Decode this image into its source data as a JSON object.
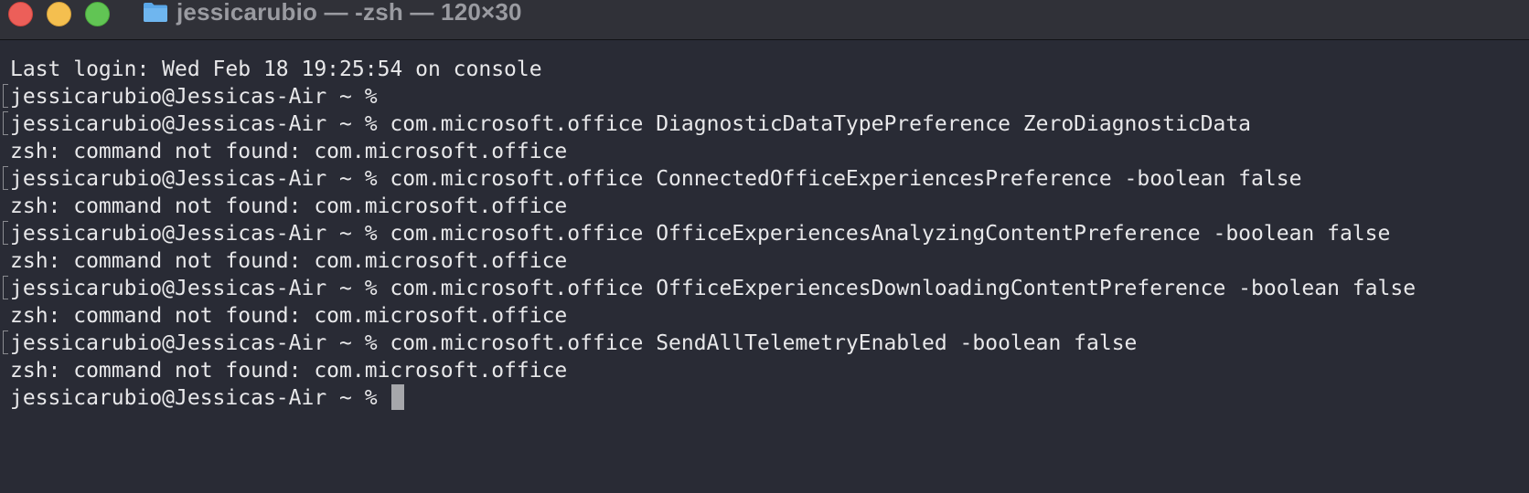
{
  "window": {
    "title": "jessicarubio — -zsh — 120×30",
    "icon": "folder-icon"
  },
  "terminal": {
    "lines": [
      {
        "text": "Last login: Wed Feb 18 19:25:54 on console",
        "marked": false
      },
      {
        "text": "jessicarubio@Jessicas-Air ~ % ",
        "marked": true
      },
      {
        "text": "jessicarubio@Jessicas-Air ~ % com.microsoft.office DiagnosticDataTypePreference ZeroDiagnosticData",
        "marked": true
      },
      {
        "text": "zsh: command not found: com.microsoft.office",
        "marked": false
      },
      {
        "text": "jessicarubio@Jessicas-Air ~ % com.microsoft.office ConnectedOfficeExperiencesPreference -boolean false",
        "marked": true
      },
      {
        "text": "zsh: command not found: com.microsoft.office",
        "marked": false
      },
      {
        "text": "jessicarubio@Jessicas-Air ~ % com.microsoft.office OfficeExperiencesAnalyzingContentPreference -boolean false",
        "marked": true
      },
      {
        "text": "zsh: command not found: com.microsoft.office",
        "marked": false
      },
      {
        "text": "jessicarubio@Jessicas-Air ~ % com.microsoft.office OfficeExperiencesDownloadingContentPreference -boolean false",
        "marked": true
      },
      {
        "text": "zsh: command not found: com.microsoft.office",
        "marked": false
      },
      {
        "text": "jessicarubio@Jessicas-Air ~ % com.microsoft.office SendAllTelemetryEnabled -boolean false",
        "marked": true
      },
      {
        "text": "zsh: command not found: com.microsoft.office",
        "marked": false
      }
    ],
    "prompt": "jessicarubio@Jessicas-Air ~ % "
  },
  "colors": {
    "background": "#292b35",
    "text": "#e8e8ea",
    "cursor": "#a6a7ab"
  }
}
